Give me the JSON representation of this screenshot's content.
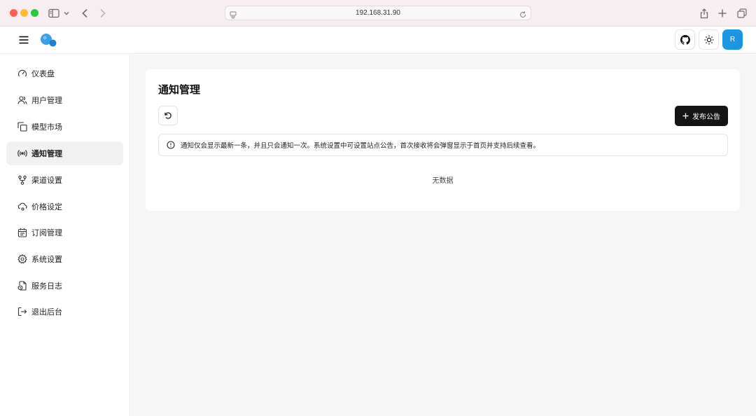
{
  "browser": {
    "url": "192.168.31.90",
    "icons": [
      "sidebar-icon",
      "chevron-down-icon",
      "back-arrow-icon",
      "forward-arrow-icon",
      "share-icon",
      "new-tab-plus-icon",
      "tab-overview-icon",
      "reload-icon"
    ]
  },
  "header": {
    "icons": [
      "hamburger-menu-icon",
      "app-logo",
      "github-icon",
      "sun-theme-icon"
    ],
    "avatar_letter": "R",
    "avatar_color": "#1e95e0"
  },
  "sidebar": {
    "items": [
      {
        "label": "仪表盘",
        "icon": "dashboard-gauge-icon",
        "active": false
      },
      {
        "label": "用户管理",
        "icon": "users-icon",
        "active": false
      },
      {
        "label": "模型市场",
        "icon": "copy-stack-icon",
        "active": false
      },
      {
        "label": "通知管理",
        "icon": "broadcast-icon",
        "active": true
      },
      {
        "label": "渠道设置",
        "icon": "git-fork-icon",
        "active": false
      },
      {
        "label": "价格设定",
        "icon": "cloud-cog-icon",
        "active": false
      },
      {
        "label": "订阅管理",
        "icon": "calendar-icon",
        "active": false
      },
      {
        "label": "系统设置",
        "icon": "gear-icon",
        "active": false
      },
      {
        "label": "服务日志",
        "icon": "file-clock-icon",
        "active": false
      },
      {
        "label": "退出后台",
        "icon": "logout-icon",
        "active": false
      }
    ]
  },
  "main": {
    "title": "通知管理",
    "publish_label": "发布公告",
    "notice_text": "通知仅会显示最新一条，并且只会通知一次。系统设置中可设置站点公告，首次接收将会弹窗显示于首页并支持后续查看。",
    "empty_text": "无数据",
    "accent_color": "#141414"
  }
}
